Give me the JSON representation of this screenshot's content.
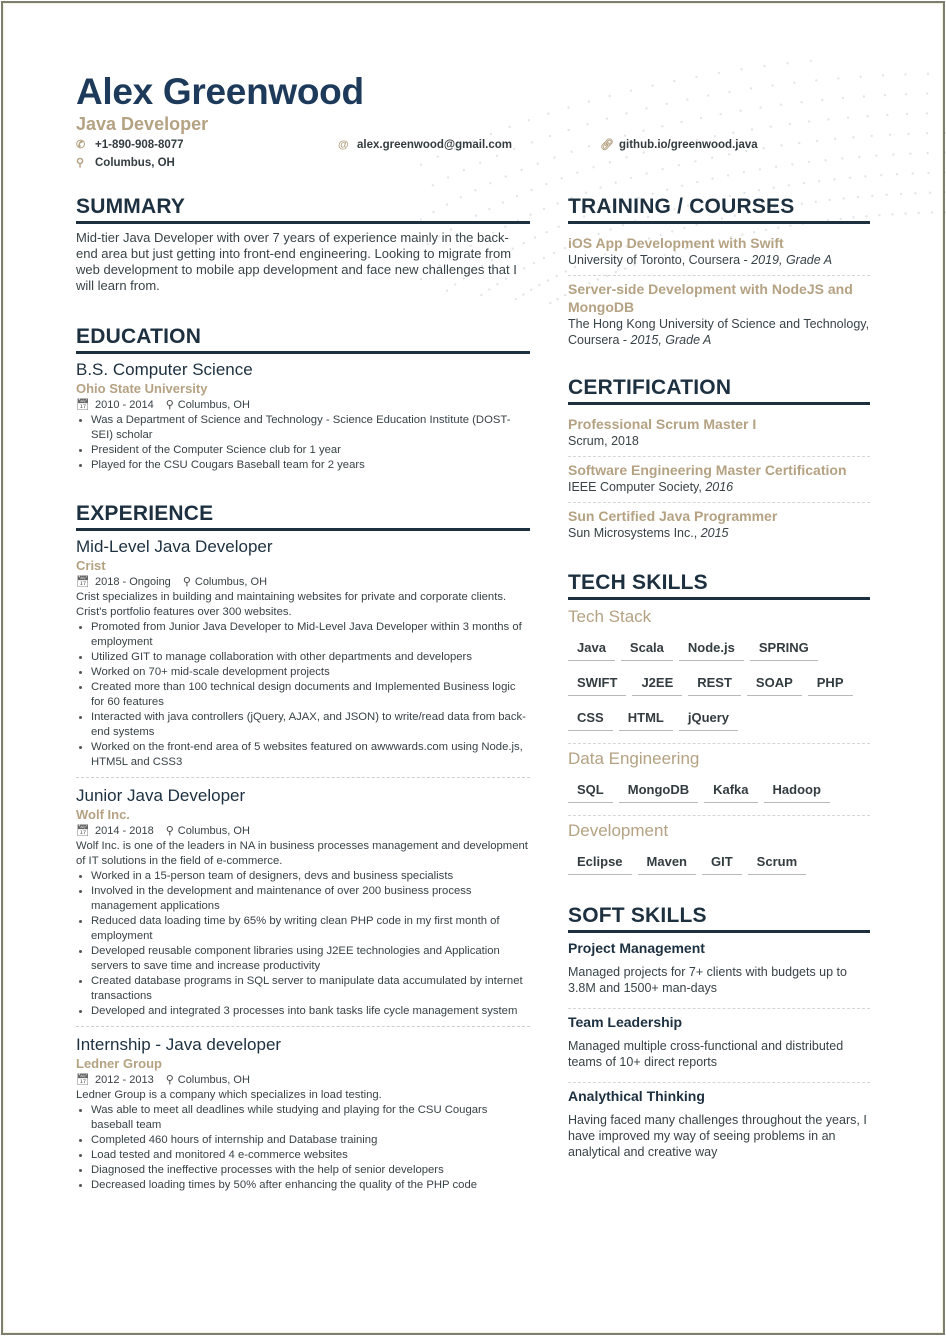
{
  "header": {
    "name": "Alex Greenwood",
    "title": "Java Developer",
    "phone": "+1-890-908-8077",
    "email": "alex.greenwood@gmail.com",
    "website": "github.io/greenwood.java",
    "location": "Columbus, OH",
    "icons": {
      "phone": "phone-icon",
      "email": "at-icon",
      "website": "link-icon",
      "location": "location-pin-icon"
    }
  },
  "colors": {
    "primary": "#1d3a5a",
    "accent": "#b5a283",
    "text": "#384347"
  },
  "summary": {
    "heading": "SUMMARY",
    "text": "Mid-tier Java Developer with over 7 years of experience mainly in the back-end area but just getting into front-end engineering. Looking to migrate from web development to mobile app development and face new challenges that I will learn from."
  },
  "education": {
    "heading": "EDUCATION",
    "items": [
      {
        "degree": "B.S. Computer Science",
        "school": "Ohio State University",
        "dates": "2010 - 2014",
        "location": "Columbus, OH",
        "bullets": [
          "Was a Department of Science and Technology - Science Education Institute (DOST-SEI) scholar",
          "President of the Computer Science club for 1 year",
          "Played for the CSU Cougars Baseball team for 2 years"
        ]
      }
    ]
  },
  "experience": {
    "heading": "EXPERIENCE",
    "items": [
      {
        "role": "Mid-Level Java Developer",
        "company": "Crist",
        "dates": "2018 - Ongoing",
        "location": "Columbus, OH",
        "description": "Crist specializes in building and maintaining websites for private and corporate clients. Crist's portfolio features over 300 websites.",
        "bullets": [
          "Promoted from Junior Java Developer to Mid-Level Java Developer within 3 months of employment",
          "Utilized GIT to manage collaboration with other departments and developers",
          "Worked on 70+ mid-scale development projects",
          "Created more than 100 technical design documents and Implemented Business logic for 60 features",
          "Interacted with java controllers (jQuery, AJAX, and JSON) to write/read data from back-end systems",
          "Worked on the front-end area of 5 websites featured on awwwards.com using Node.js, HTM5L and CSS3"
        ]
      },
      {
        "role": "Junior Java Developer",
        "company": "Wolf Inc.",
        "dates": "2014 - 2018",
        "location": "Columbus, OH",
        "description": "Wolf Inc. is one of the leaders in NA in business processes management and development of IT solutions in the field of e-commerce.",
        "bullets": [
          "Worked in a 15-person team of designers, devs and business specialists",
          "Involved in the development and maintenance of over 200 business process management applications",
          "Reduced data loading time by 65% by writing clean PHP code in my first month of employment",
          "Developed reusable component libraries using J2EE technologies and Application servers to save time and increase productivity",
          "Created database programs in SQL server to manipulate data accumulated by internet transactions",
          "Developed and integrated 3 processes into bank tasks life cycle management system"
        ]
      },
      {
        "role": "Internship - Java developer",
        "company": "Ledner Group",
        "dates": "2012 - 2013",
        "location": "Columbus, OH",
        "description": "Ledner Group is a company which specializes in load testing.",
        "bullets": [
          "Was able to meet all deadlines while studying and playing for the CSU Cougars baseball team",
          "Completed 460 hours of internship and Database training",
          "Load tested and monitored 4 e-commerce websites",
          "Diagnosed the ineffective processes with the help of senior developers",
          "Decreased loading times by 50% after enhancing the quality of the PHP code"
        ]
      }
    ]
  },
  "training": {
    "heading": "TRAINING / COURSES",
    "items": [
      {
        "title": "iOS App Development with Swift",
        "provider": "University of Toronto, Coursera - ",
        "detail": "2019, Grade A"
      },
      {
        "title": "Server-side Development with NodeJS and MongoDB",
        "provider": "The Hong Kong University of Science and Technology, Coursera - ",
        "detail": "2015, Grade A"
      }
    ]
  },
  "certification": {
    "heading": "CERTIFICATION",
    "items": [
      {
        "title": "Professional Scrum Master I",
        "issuer": "Scrum, ",
        "year": "2018",
        "year_italic": false
      },
      {
        "title": "Software Engineering Master Certification",
        "issuer": "IEEE Computer Society, ",
        "year": "2016",
        "year_italic": true
      },
      {
        "title": "Sun Certified Java Programmer",
        "issuer": "Sun Microsystems Inc., ",
        "year": "2015",
        "year_italic": true
      }
    ]
  },
  "tech_skills": {
    "heading": "TECH SKILLS",
    "groups": [
      {
        "name": "Tech Stack",
        "skills": [
          "Java",
          "Scala",
          "Node.js",
          "SPRING",
          "SWIFT",
          "J2EE",
          "REST",
          "SOAP",
          "PHP",
          "CSS",
          "HTML",
          "jQuery"
        ]
      },
      {
        "name": "Data Engineering",
        "skills": [
          "SQL",
          "MongoDB",
          "Kafka",
          "Hadoop"
        ]
      },
      {
        "name": "Development",
        "skills": [
          "Eclipse",
          "Maven",
          "GIT",
          "Scrum"
        ]
      }
    ]
  },
  "soft_skills": {
    "heading": "SOFT SKILLS",
    "items": [
      {
        "title": "Project Management",
        "text": "Managed projects for 7+ clients with budgets up to 3.8M and 1500+ man-days"
      },
      {
        "title": "Team Leadership",
        "text": "Managed multiple cross-functional and distributed teams of 10+ direct reports"
      },
      {
        "title": "Analythical Thinking",
        "text": "Having faced many challenges throughout the years, I have improved my way of seeing problems in an analytical and creative way"
      }
    ]
  }
}
